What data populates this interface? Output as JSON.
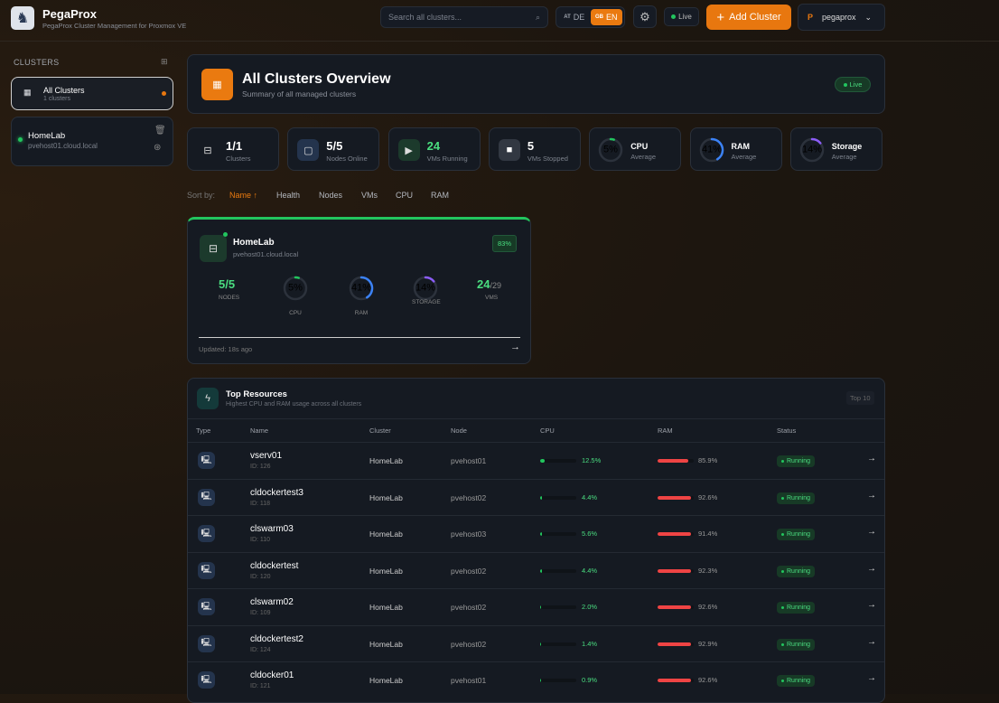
{
  "header": {
    "brand": "PegaProx",
    "subtitle": "PegaProx Cluster Management for Proxmox VE",
    "search_placeholder": "Search all clusters...",
    "lang_de_flag": "AT",
    "lang_de": "DE",
    "lang_en_flag": "GB",
    "lang_en": "EN",
    "live": "Live",
    "add_cluster": "Add Cluster",
    "user_initial": "P",
    "user": "pegaprox"
  },
  "sidebar": {
    "title": "CLUSTERS",
    "items": [
      {
        "name": "All Clusters",
        "sub": "1 clusters"
      },
      {
        "name": "HomeLab",
        "sub": "pvehost01.cloud.local"
      }
    ]
  },
  "overview": {
    "title": "All Clusters Overview",
    "subtitle": "Summary of all managed clusters",
    "live": "Live"
  },
  "stats": [
    {
      "value": "1/1",
      "label": "Clusters"
    },
    {
      "value": "5/5",
      "label": "Nodes Online"
    },
    {
      "value": "24",
      "label": "VMs Running"
    },
    {
      "value": "5",
      "label": "VMs Stopped"
    }
  ],
  "gauges": [
    {
      "label": "CPU",
      "sub": "Average",
      "value": 5,
      "text": "5%",
      "color": "#22c55e"
    },
    {
      "label": "RAM",
      "sub": "Average",
      "value": 41,
      "text": "41%",
      "color": "#3b82f6"
    },
    {
      "label": "Storage",
      "sub": "Average",
      "value": 14,
      "text": "14%",
      "color": "#8b5cf6"
    }
  ],
  "sort": {
    "label": "Sort by:",
    "options": [
      "Name ↑",
      "Health",
      "Nodes",
      "VMs",
      "CPU",
      "RAM"
    ]
  },
  "cluster": {
    "name": "HomeLab",
    "host": "pvehost01.cloud.local",
    "health": "83%",
    "nodes": "5/5",
    "nodes_label": "NODES",
    "cpu": "5%",
    "cpu_label": "CPU",
    "cpu_value": 5,
    "ram": "41%",
    "ram_label": "RAM",
    "ram_value": 41,
    "storage": "14%",
    "storage_label": "STORAGE",
    "storage_value": 14,
    "vms": "24",
    "vms_total": "/29",
    "vms_label": "VMS",
    "updated": "Updated: 18s ago"
  },
  "top": {
    "title": "Top Resources",
    "subtitle": "Highest CPU and RAM usage across all clusters",
    "badge": "Top 10",
    "columns": [
      "Type",
      "Name",
      "Cluster",
      "Node",
      "CPU",
      "RAM",
      "Status"
    ],
    "rows": [
      {
        "name": "vserv01",
        "id": "ID: 126",
        "cluster": "HomeLab",
        "node": "pvehost01",
        "cpu": 12.5,
        "cpu_text": "12.5%",
        "ram": 85.9,
        "ram_text": "85.9%",
        "status": "Running"
      },
      {
        "name": "cldockertest3",
        "id": "ID: 118",
        "cluster": "HomeLab",
        "node": "pvehost02",
        "cpu": 4.4,
        "cpu_text": "4.4%",
        "ram": 92.6,
        "ram_text": "92.6%",
        "status": "Running"
      },
      {
        "name": "clswarm03",
        "id": "ID: 110",
        "cluster": "HomeLab",
        "node": "pvehost03",
        "cpu": 5.6,
        "cpu_text": "5.6%",
        "ram": 91.4,
        "ram_text": "91.4%",
        "status": "Running"
      },
      {
        "name": "cldockertest",
        "id": "ID: 120",
        "cluster": "HomeLab",
        "node": "pvehost02",
        "cpu": 4.4,
        "cpu_text": "4.4%",
        "ram": 92.3,
        "ram_text": "92.3%",
        "status": "Running"
      },
      {
        "name": "clswarm02",
        "id": "ID: 109",
        "cluster": "HomeLab",
        "node": "pvehost02",
        "cpu": 2.0,
        "cpu_text": "2.0%",
        "ram": 92.6,
        "ram_text": "92.6%",
        "status": "Running"
      },
      {
        "name": "cldockertest2",
        "id": "ID: 124",
        "cluster": "HomeLab",
        "node": "pvehost02",
        "cpu": 1.4,
        "cpu_text": "1.4%",
        "ram": 92.9,
        "ram_text": "92.9%",
        "status": "Running"
      },
      {
        "name": "cldocker01",
        "id": "ID: 121",
        "cluster": "HomeLab",
        "node": "pvehost01",
        "cpu": 0.9,
        "cpu_text": "0.9%",
        "ram": 92.6,
        "ram_text": "92.6%",
        "status": "Running"
      }
    ]
  }
}
